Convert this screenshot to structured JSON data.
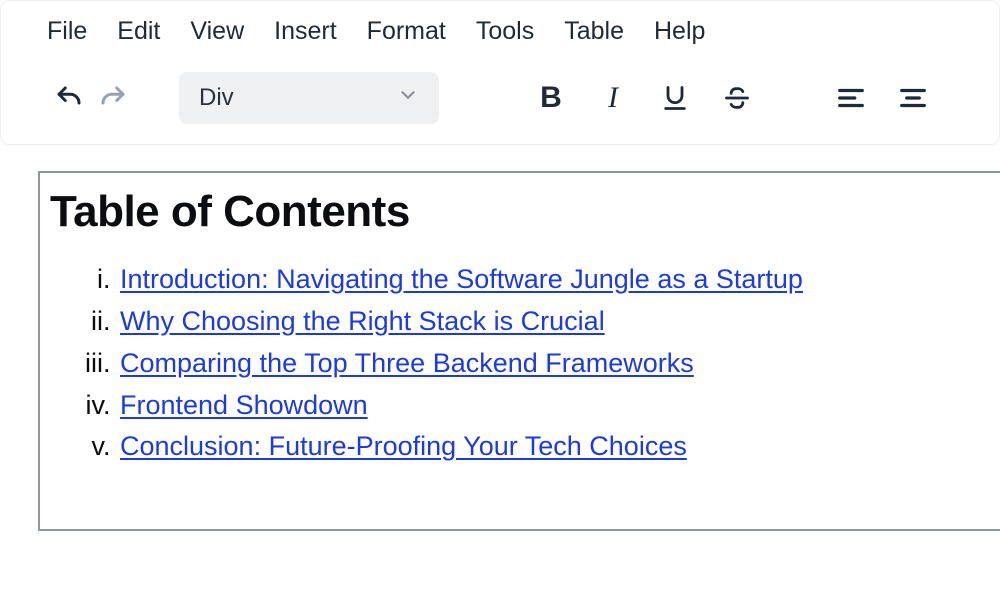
{
  "menubar": {
    "file": "File",
    "edit": "Edit",
    "view": "View",
    "insert": "Insert",
    "format": "Format",
    "tools": "Tools",
    "table": "Table",
    "help": "Help"
  },
  "toolbar": {
    "format_select_value": "Div",
    "bold_label": "B",
    "italic_label": "I"
  },
  "document": {
    "toc_title": "Table of Contents",
    "toc_items": {
      "i1": "Introduction: Navigating the Software Jungle as a Startup",
      "i2": "Why Choosing the Right Stack is Crucial",
      "i3": "Comparing the Top Three Backend Frameworks",
      "i4": "Frontend Showdown",
      "i5": "Conclusion: Future-Proofing Your Tech Choices"
    }
  }
}
